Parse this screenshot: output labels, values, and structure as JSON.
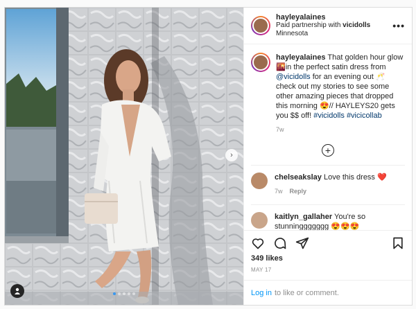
{
  "post": {
    "username": "hayleyalaines",
    "paid_partnership_prefix": "Paid partnership with ",
    "partner": "vicidolls",
    "location": "Minnesota"
  },
  "caption": {
    "username": "hayleyalaines",
    "text_1": " That golden hour glow 🌇in the perfect satin dress from ",
    "mention": "@vicidolls",
    "text_2": " for an evening out 🥂check out my stories to see some other amazing pieces that dropped this morning 😍// HAYLEYS20 gets you $$ off! ",
    "hashtag_1": "#vicidolls",
    "hashtag_2": "#vicicollab",
    "age": "7w"
  },
  "load_more_symbol": "+",
  "comments": [
    {
      "username": "chelseakslay",
      "text": "Love this dress",
      "emoji": "❤️",
      "age": "7w",
      "reply": "Reply"
    },
    {
      "username": "kaitlyn_gallaher",
      "text": "You're so stunninggggggg 😍😍😍"
    }
  ],
  "likes": "349 likes",
  "date": "MAY 17",
  "login": {
    "link": "Log in",
    "text": "to like or comment."
  },
  "carousel": {
    "slides": 5,
    "active": 1
  },
  "icons": [
    "heart-icon",
    "comment-icon",
    "share-icon",
    "bookmark-icon",
    "more-icon",
    "user-tag-icon",
    "chevron-right-icon",
    "plus-circle-icon"
  ]
}
